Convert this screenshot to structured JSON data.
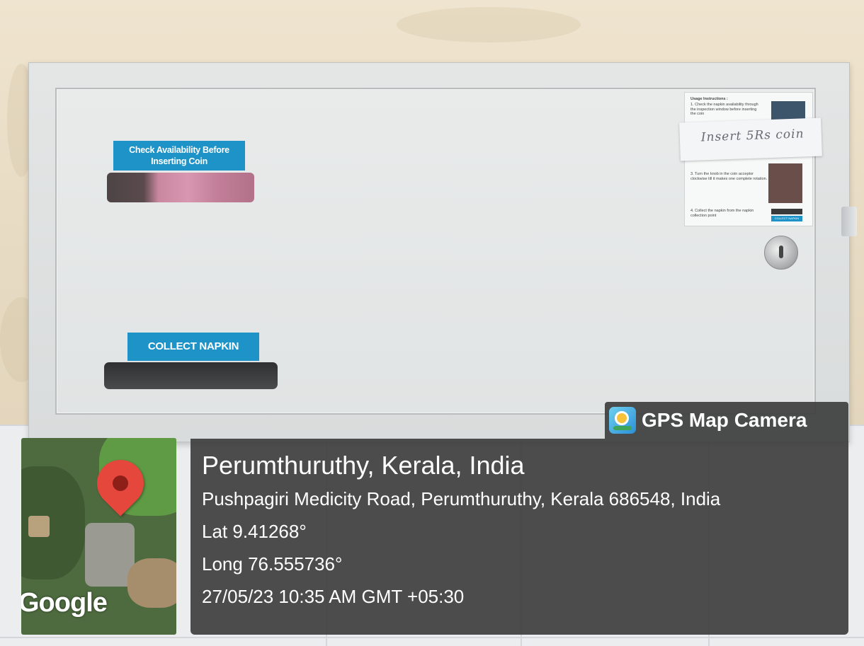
{
  "cabinet": {
    "label_check": "Check Availability Before Inserting Coin",
    "label_collect": "COLLECT NAPKIN",
    "instructions": {
      "heading": "Usage Instructions :",
      "step1": "1. Check the napkin availability through the inspection window before inserting the coin",
      "step3": "3. Turn the knob in the coin acceptor clockwise till it makes one complete rotation.",
      "step4": "4. Collect the napkin from the napkin collection point",
      "tag": "COLLECT NAPKIN"
    },
    "handwritten_note": "Insert 5Rs coin"
  },
  "overlay": {
    "badge_title": "GPS Map Camera",
    "map_brand": "Google",
    "city": "Perumthuruthy, Kerala, India",
    "address": "Pushpagiri Medicity Road, Perumthuruthy, Kerala 686548, India",
    "lat": "Lat 9.41268°",
    "long": "Long 76.555736°",
    "datetime": "27/05/23 10:35 AM GMT +05:30",
    "colors": {
      "panel": "#3e3e3e",
      "pin": "#e5473d",
      "label_blue": "#1e93c7"
    },
    "icons": [
      "gps-map-camera-icon",
      "map-pin-icon"
    ]
  }
}
